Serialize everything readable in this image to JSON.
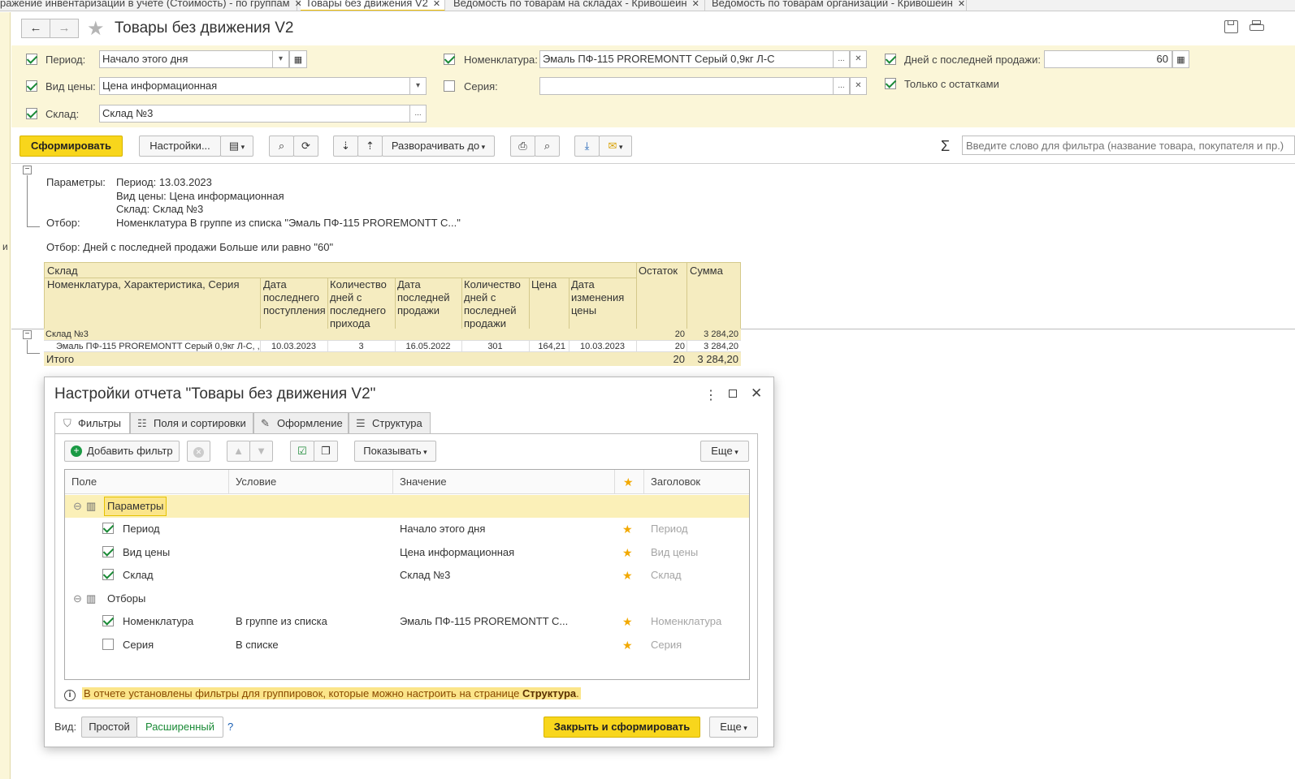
{
  "tabs": [
    {
      "label": "ражение инвентаризации в учете (Стоимость) - по группам"
    },
    {
      "label": "Товары без движения V2"
    },
    {
      "label": "Ведомость по товарам на складах - Кривошеин"
    },
    {
      "label": "Ведомость по товарам организаций - Кривошеин"
    }
  ],
  "left_strip_letter": "и",
  "header": {
    "title": "Товары без движения V2"
  },
  "filters": {
    "period_label": "Период:",
    "period_value": "Начало этого дня",
    "price_label": "Вид цены:",
    "price_value": "Цена информационная",
    "warehouse_label": "Склад:",
    "warehouse_value": "Склад №3",
    "nomen_label": "Номенклатура:",
    "nomen_value": "Эмаль ПФ-115 PROREMONTT Серый 0,9кг Л-С",
    "series_label": "Серия:",
    "series_value": "",
    "days_label": "Дней с последней продажи:",
    "days_value": "60",
    "only_stock_label": "Только с остатками"
  },
  "toolbar": {
    "generate": "Сформировать",
    "settings": "Настройки...",
    "expand_to": "Разворачивать до",
    "search_placeholder": "Введите слово для фильтра (название товара, покупателя и пр.)"
  },
  "report": {
    "params_label": "Параметры:",
    "params_lines": [
      "Период: 13.03.2023",
      "Вид цены: Цена информационная",
      "Склад: Склад №3"
    ],
    "filter_label": "Отбор:",
    "filter_value": "Номенклатура В группе из списка \"Эмаль ПФ-115 PROREMONTT С...\"",
    "filter2": "Отбор: Дней с последней продажи Больше или равно \"60\"",
    "headers": {
      "warehouse": "Склад",
      "nomen": "Номенклатура, Характеристика, Серия",
      "last_receipt": [
        "Дата",
        "последнего",
        "поступления"
      ],
      "days_receipt": [
        "Количество",
        "дней с",
        "последнего",
        "прихода"
      ],
      "last_sale": [
        "Дата",
        "последней",
        "продажи"
      ],
      "days_sale": [
        "Количество",
        "дней с",
        "последней",
        "продажи"
      ],
      "price": "Цена",
      "price_change": [
        "Дата",
        "изменения",
        "цены"
      ],
      "balance": "Остаток",
      "sum": "Сумма"
    },
    "group_row": {
      "name": "Склад №3",
      "balance": "20",
      "sum": "3 284,20"
    },
    "item_row": {
      "name": "Эмаль ПФ-115 PROREMONTT Серый 0,9кг Л-С, ,",
      "last_receipt": "10.03.2023",
      "days_receipt": "3",
      "last_sale": "16.05.2022",
      "days_sale": "301",
      "price": "164,21",
      "price_change": "10.03.2023",
      "balance": "20",
      "sum": "3 284,20"
    },
    "total_row": {
      "name": "Итого",
      "balance": "20",
      "sum": "3 284,20"
    }
  },
  "dialog": {
    "title": "Настройки отчета \"Товары без движения V2\"",
    "tabs": [
      "Фильтры",
      "Поля и сортировки",
      "Оформление",
      "Структура"
    ],
    "add_filter": "Добавить фильтр",
    "show": "Показывать",
    "more": "Еще",
    "columns": [
      "Поле",
      "Условие",
      "Значение",
      "Заголовок"
    ],
    "rows": [
      {
        "field": "Параметры",
        "condition": "",
        "value": "",
        "caption": ""
      },
      {
        "field": "Период",
        "condition": "",
        "value": "Начало этого дня",
        "caption": "Период"
      },
      {
        "field": "Вид цены",
        "condition": "",
        "value": "Цена информационная",
        "caption": "Вид цены"
      },
      {
        "field": "Склад",
        "condition": "",
        "value": "Склад №3",
        "caption": "Склад"
      },
      {
        "field": "Отборы",
        "condition": "",
        "value": "",
        "caption": ""
      },
      {
        "field": "Номенклатура",
        "condition": "В группе из списка",
        "value": "Эмаль ПФ-115 PROREMONTT С...",
        "caption": "Номенклатура"
      },
      {
        "field": "Серия",
        "condition": "В списке",
        "value": "",
        "caption": "Серия"
      }
    ],
    "info_text": "В отчете установлены фильтры для группировок, которые можно настроить на странице ",
    "info_link": "Структура",
    "info_end": ".",
    "view_label": "Вид:",
    "view_simple": "Простой",
    "view_extended": "Расширенный",
    "help": "?",
    "close_generate": "Закрыть и сформировать",
    "more2": "Еще"
  },
  "colors": {
    "accent": "#f8d61c",
    "panel": "#fbf6d8",
    "check": "#1a8a36",
    "star": "#f2a900"
  }
}
